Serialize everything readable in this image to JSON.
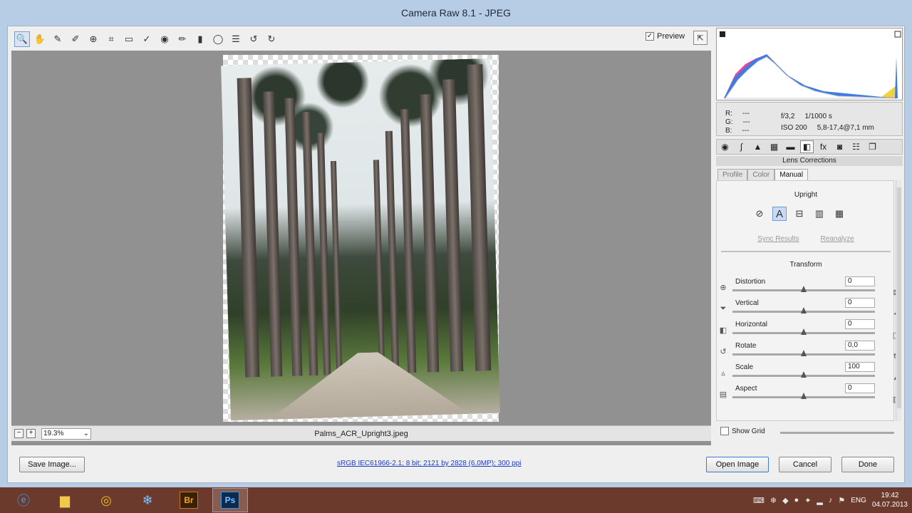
{
  "window": {
    "title": "Camera Raw 8.1  -  JPEG"
  },
  "toolbar": {
    "tools": [
      {
        "name": "zoom-tool-icon",
        "glyph": "🔍"
      },
      {
        "name": "hand-tool-icon",
        "glyph": "✋"
      },
      {
        "name": "white-balance-tool-icon",
        "glyph": "✎"
      },
      {
        "name": "color-sampler-tool-icon",
        "glyph": "✐"
      },
      {
        "name": "targeted-adjustment-tool-icon",
        "glyph": "⊕"
      },
      {
        "name": "crop-tool-icon",
        "glyph": "⌗"
      },
      {
        "name": "straighten-tool-icon",
        "glyph": "▭"
      },
      {
        "name": "spot-removal-tool-icon",
        "glyph": "✓"
      },
      {
        "name": "red-eye-tool-icon",
        "glyph": "◉"
      },
      {
        "name": "adjustment-brush-icon",
        "glyph": "✏"
      },
      {
        "name": "graduated-filter-icon",
        "glyph": "▮"
      },
      {
        "name": "radial-filter-icon",
        "glyph": "◯"
      },
      {
        "name": "preferences-icon",
        "glyph": "☰"
      },
      {
        "name": "rotate-ccw-icon",
        "glyph": "↺"
      },
      {
        "name": "rotate-cw-icon",
        "glyph": "↻"
      }
    ],
    "preview_label": "Preview",
    "preview_checked": "✓"
  },
  "statusbar": {
    "zoom_value": "19.3%",
    "filename": "Palms_ACR_Upright3.jpeg"
  },
  "info": {
    "r_label": "R:",
    "g_label": "G:",
    "b_label": "B:",
    "r_value": "---",
    "g_value": "---",
    "b_value": "---",
    "aperture": "f/3,2",
    "shutter": "1/1000 s",
    "iso": "ISO 200",
    "lens": "5,8-17,4@7,1 mm"
  },
  "panel": {
    "section_title": "Lens Corrections",
    "subtabs": [
      "Profile",
      "Color",
      "Manual"
    ],
    "upright_title": "Upright",
    "upright_active_glyph": "A",
    "sync_results": "Sync Results",
    "reanalyze": "Reanalyze",
    "transform_title": "Transform",
    "sliders": [
      {
        "label": "Distortion",
        "value": "0"
      },
      {
        "label": "Vertical",
        "value": "0"
      },
      {
        "label": "Horizontal",
        "value": "0"
      },
      {
        "label": "Rotate",
        "value": "0,0"
      },
      {
        "label": "Scale",
        "value": "100"
      },
      {
        "label": "Aspect",
        "value": "0"
      }
    ],
    "show_grid": "Show Grid"
  },
  "bottom": {
    "save_image": "Save Image...",
    "workflow_link": "sRGB IEC61966-2.1; 8 bit; 2121 by 2828 (6,0MP); 300 ppi",
    "open_image": "Open Image",
    "cancel": "Cancel",
    "done": "Done"
  },
  "taskbar": {
    "br_label": "Br",
    "ps_label": "Ps",
    "lang": "ENG",
    "time": "19:42",
    "date": "04.07.2013"
  }
}
